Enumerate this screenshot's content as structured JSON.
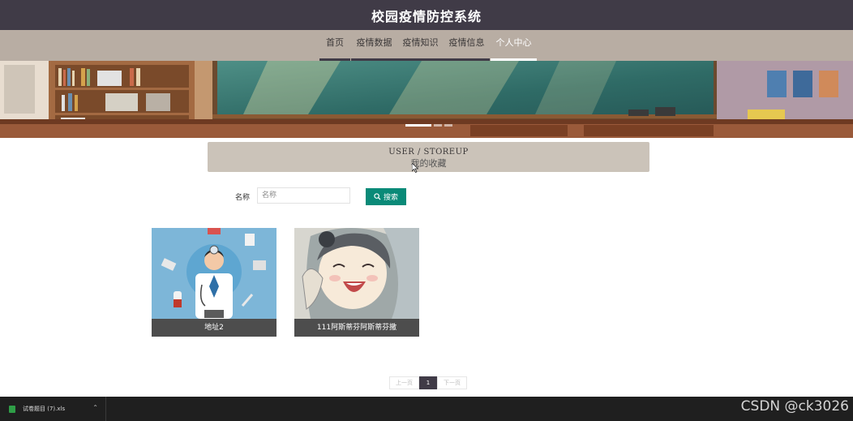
{
  "header": {
    "title": "校园疫情防控系统"
  },
  "nav": {
    "items": [
      {
        "label": "首页"
      },
      {
        "label": "疫情数据"
      },
      {
        "label": "疫情知识"
      },
      {
        "label": "疫情信息"
      },
      {
        "label": "个人中心"
      }
    ],
    "active": "个人中心"
  },
  "banner": {
    "slide_count": 3,
    "active_slide": 1
  },
  "section": {
    "title_en": "USER / STOREUP",
    "title_cn": "我的收藏"
  },
  "search": {
    "label": "名称",
    "placeholder": "名称",
    "value": "",
    "button_label": "搜索"
  },
  "cards": [
    {
      "caption": "地址2",
      "image": "doctor-illustration"
    },
    {
      "caption": "111阿斯蒂芬阿斯蒂芬撒",
      "image": "anime-girl-illustration"
    }
  ],
  "pagination": {
    "prev_label": "上一页",
    "current_page": "1",
    "next_label": "下一页"
  },
  "taskbar": {
    "download_name": "试卷题目 (7).xls"
  },
  "watermark": "CSDN @ck3026",
  "colors": {
    "header_bg": "#403b47",
    "nav_bg": "#b8ada3",
    "accent": "#0a8a78",
    "title_box": "#cbc3b9"
  }
}
